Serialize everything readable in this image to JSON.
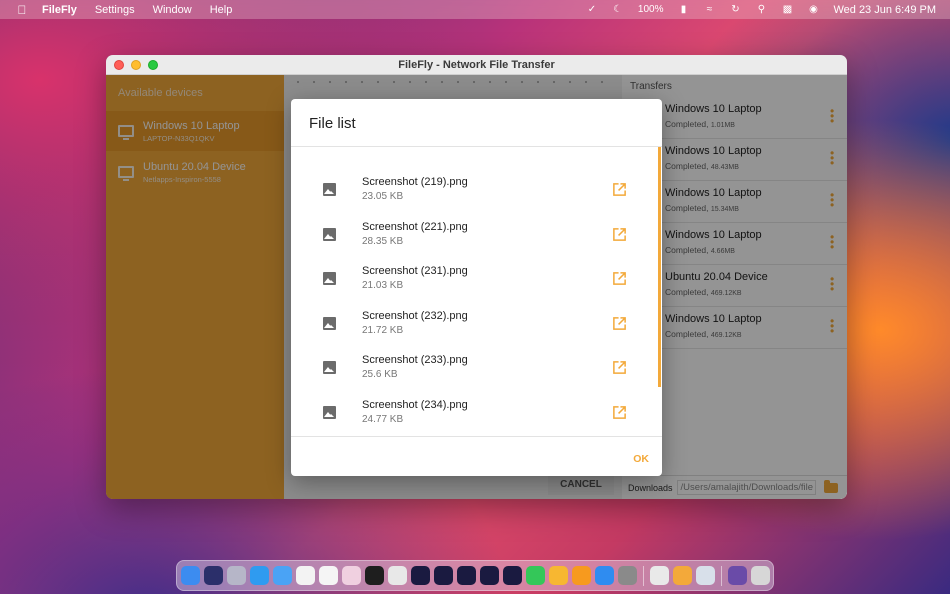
{
  "menubar": {
    "app_name": "FileFly",
    "menus": [
      "Settings",
      "Window",
      "Help"
    ],
    "battery": "100%",
    "datetime": "Wed 23 Jun  6:49 PM"
  },
  "window": {
    "title": "FileFly - Network File Transfer"
  },
  "sidebar": {
    "title": "Available devices",
    "devices": [
      {
        "name": "Windows 10 Laptop",
        "sub": "LAPTOP-N33Q1QKV"
      },
      {
        "name": "Ubuntu 20.04 Device",
        "sub": "Netlapps-Inspiron-5558"
      }
    ]
  },
  "middle": {
    "cancel_label": "CANCEL"
  },
  "transfers": {
    "title": "Transfers",
    "items": [
      {
        "name": "Windows 10 Laptop",
        "status": "Completed,",
        "size": "1.01MB"
      },
      {
        "name": "Windows 10 Laptop",
        "status": "Completed,",
        "size": "48.43MB"
      },
      {
        "name": "Windows 10 Laptop",
        "status": "Completed,",
        "size": "15.34MB"
      },
      {
        "name": "Windows 10 Laptop",
        "status": "Completed,",
        "size": "4.66MB"
      },
      {
        "name": "Ubuntu 20.04 Device",
        "status": "Completed,",
        "size": "469.12KB"
      },
      {
        "name": "Windows 10 Laptop",
        "status": "Completed,",
        "size": "469.12KB"
      }
    ],
    "downloads_label": "Downloads",
    "downloads_path": "/Users/amalajith/Downloads/file"
  },
  "dialog": {
    "title": "File list",
    "files": [
      {
        "name": "Screenshot (219).png",
        "size": "23.05 KB"
      },
      {
        "name": "Screenshot (221).png",
        "size": "28.35 KB"
      },
      {
        "name": "Screenshot (231).png",
        "size": "21.03 KB"
      },
      {
        "name": "Screenshot (232).png",
        "size": "21.72 KB"
      },
      {
        "name": "Screenshot (233).png",
        "size": "25.6 KB"
      },
      {
        "name": "Screenshot (234).png",
        "size": "24.77 KB"
      }
    ],
    "ok_label": "OK"
  },
  "colors": {
    "accent": "#f3a93a",
    "sidebar_selected": "#e89a2a"
  },
  "icons": {
    "file_icon": "image-icon",
    "open_icon": "open-external-icon",
    "device_icon": "monitor-icon",
    "menu_icon": "kebab-menu-icon"
  }
}
